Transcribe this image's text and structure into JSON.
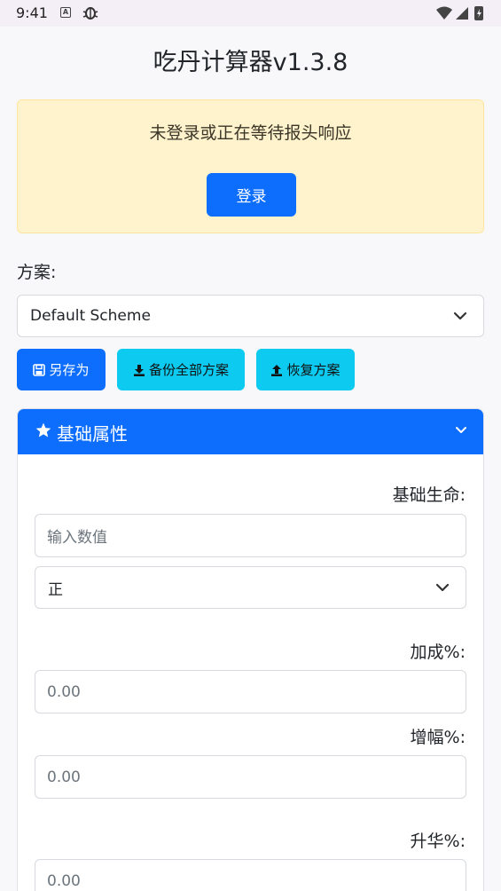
{
  "status": {
    "time": "9:41"
  },
  "app": {
    "title": "吃丹计算器v1.3.8"
  },
  "alert": {
    "message": "未登录或正在等待报头响应",
    "login_label": "登录"
  },
  "scheme": {
    "label": "方案:",
    "selected": "Default Scheme",
    "save_as_label": "另存为",
    "backup_all_label": "备份全部方案",
    "restore_label": "恢复方案"
  },
  "panel": {
    "title": "基础属性",
    "base_life_label": "基础生命:",
    "base_life_placeholder": "输入数值",
    "sign_selected": "正",
    "bonus_label": "加成%:",
    "bonus_value": "0.00",
    "amplify_label": "增幅%:",
    "amplify_value": "0.00",
    "sublimation_label": "升华%:",
    "sublimation_value": "0.00"
  },
  "colors": {
    "primary": "#0d6efd",
    "info": "#0dcaf0",
    "warning_bg": "#fff3cd"
  }
}
